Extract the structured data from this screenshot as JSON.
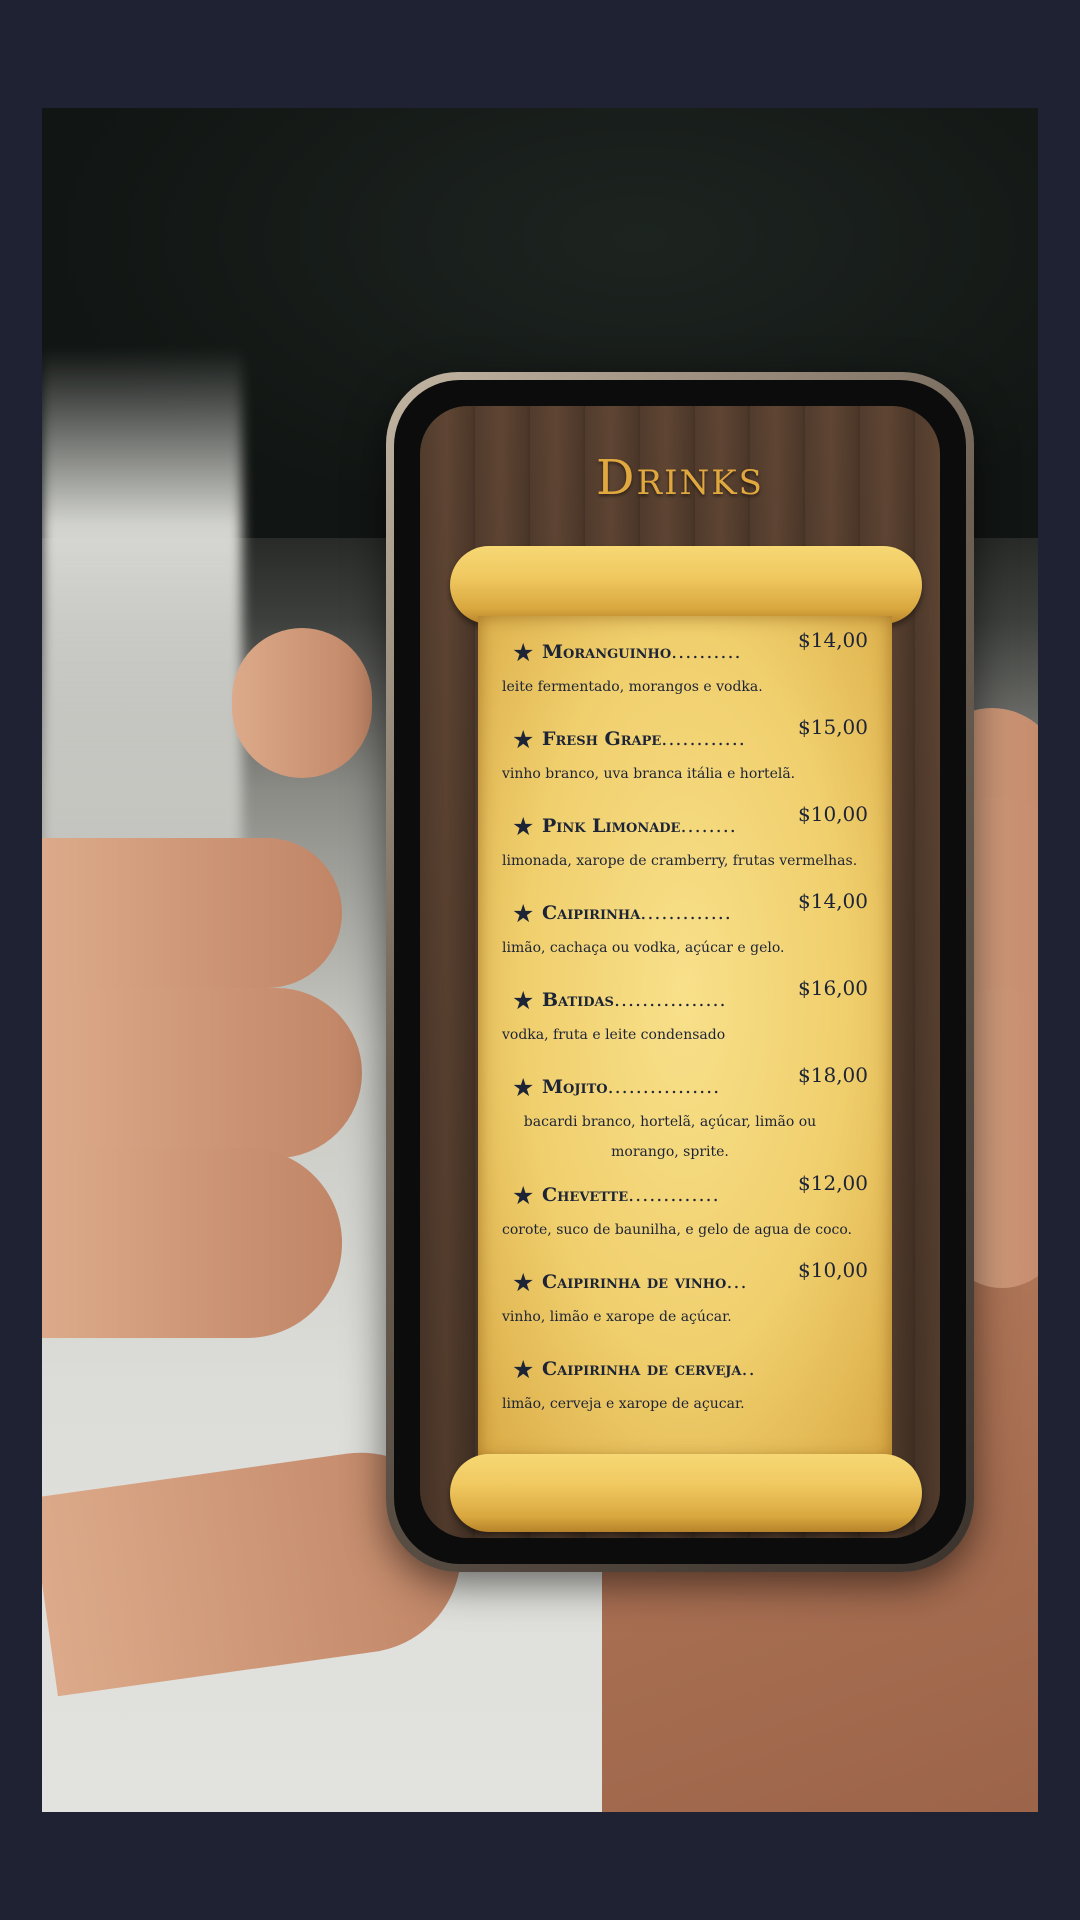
{
  "menu": {
    "title": "Drinks",
    "items": [
      {
        "name": "Moranguinho",
        "dots": "..........",
        "price": "$14,00",
        "desc": "leite fermentado, morangos e vodka."
      },
      {
        "name": "Fresh Grape",
        "dots": "............",
        "price": "$15,00",
        "desc": "vinho branco, uva branca itália e hortelã."
      },
      {
        "name": "Pink Limonade",
        "dots": "........",
        "price": "$10,00",
        "desc": "limonada, xarope de cramberry, frutas vermelhas."
      },
      {
        "name": "Caipirinha",
        "dots": ".............",
        "price": "$14,00",
        "desc": "limão, cachaça ou vodka, açúcar e gelo."
      },
      {
        "name": "Batidas",
        "dots": "................",
        "price": "$16,00",
        "desc": "vodka, fruta e leite condensado"
      },
      {
        "name": "Mojito",
        "dots": "................",
        "price": "$18,00",
        "desc": "bacardi branco, hortelã, açúcar, limão ou morango, sprite."
      },
      {
        "name": "Chevette",
        "dots": ".............",
        "price": "$12,00",
        "desc": "corote, suco de baunilha, e gelo de agua de coco."
      },
      {
        "name": "Caipirinha de vinho",
        "dots": "...",
        "price": "$10,00",
        "desc": "vinho, limão e xarope de açúcar."
      },
      {
        "name": "Caipirinha de cerveja",
        "dots": "..",
        "price": "",
        "desc": "limão, cerveja e xarope de açucar."
      }
    ]
  }
}
